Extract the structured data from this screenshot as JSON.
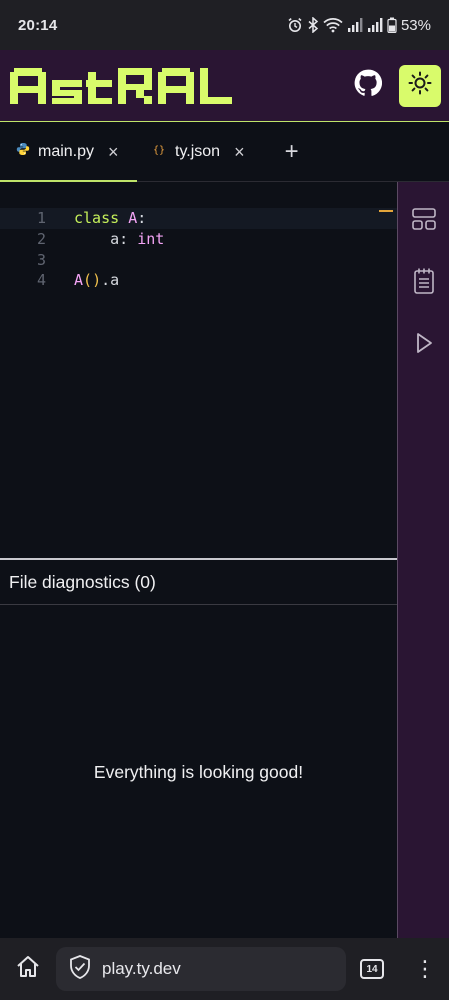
{
  "status_bar": {
    "time": "20:14",
    "battery": "53%",
    "icons": [
      "alarm-icon",
      "bluetooth-icon",
      "wifi-icon",
      "signal-icon",
      "signal-icon",
      "battery-icon"
    ]
  },
  "header": {
    "logo_text": "Astral",
    "github_icon": "github-icon",
    "theme_icon": "sun-icon",
    "accent_color": "#d9fb6b",
    "background_color": "#2a1533"
  },
  "tabs": [
    {
      "label": "main.py",
      "icon": "python-icon",
      "active": true
    },
    {
      "label": "ty.json",
      "icon": "json-icon",
      "active": false
    }
  ],
  "tab_add_label": "+",
  "tab_close_label": "×",
  "editor": {
    "line_numbers": [
      "1",
      "2",
      "3",
      "4"
    ],
    "lines": [
      {
        "keyword": "class",
        "name": "A",
        "rest": ":"
      },
      {
        "indent": "    ",
        "attr": "a",
        "sep": ": ",
        "type": "int"
      },
      {},
      {
        "call": "A",
        "open": "(",
        "close": ")",
        "rest": ".a"
      }
    ]
  },
  "diagnostics": {
    "title": "File diagnostics (0)",
    "message": "Everything is looking good!"
  },
  "sidebar": {
    "buttons": [
      "layout-icon",
      "notepad-icon",
      "play-icon"
    ]
  },
  "browser": {
    "url": "play.ty.dev",
    "tab_count": "14",
    "menu_label": "⋮"
  }
}
